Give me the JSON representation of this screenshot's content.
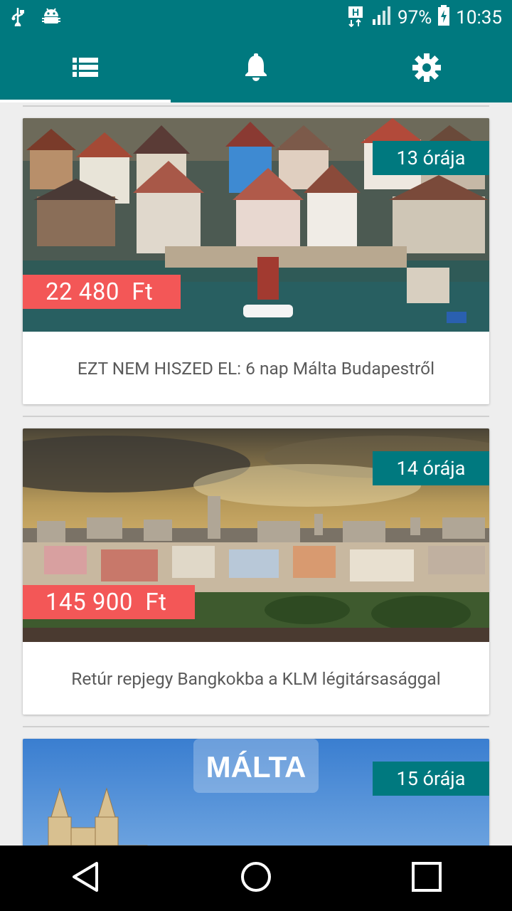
{
  "status_bar": {
    "battery": "97%",
    "time": "10:35",
    "signal_label": "H"
  },
  "tabs": [
    {
      "name": "list",
      "icon": "list-icon",
      "active": true
    },
    {
      "name": "notifications",
      "icon": "bell-icon",
      "active": false
    },
    {
      "name": "settings",
      "icon": "gear-icon",
      "active": false
    }
  ],
  "deals": [
    {
      "time": "13 órája",
      "price": "22 480  Ft",
      "title": "EZT NEM HISZED EL: 6 nap Málta Budapestről"
    },
    {
      "time": "14 órája",
      "price": "145 900  Ft",
      "title": "Retúr repjegy Bangkokba a KLM légitársasággal"
    },
    {
      "time": "15 órája",
      "image_text": "MÁLTA"
    }
  ],
  "colors": {
    "primary": "#00797f",
    "price": "#f35757"
  }
}
